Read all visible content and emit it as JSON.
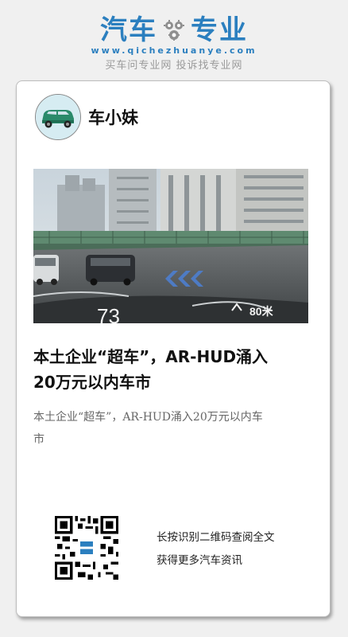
{
  "brand": {
    "name_left": "汽车",
    "name_right": "专业",
    "url": "www.qichezhuanye.com",
    "slogan": "买车问专业网 投诉找专业网",
    "color": "#2b7fbf"
  },
  "post": {
    "author": "车小妹",
    "image": {
      "speed_readout": "73",
      "distance_readout": "80米"
    },
    "title": "本土企业“超车”，AR-HUD涌入20万元以内车市",
    "summary": "本土企业“超车”，AR-HUD涌入20万元以内车市"
  },
  "share": {
    "caption_line1": "长按识别二维码查阅全文",
    "caption_line2": "获得更多汽车资讯"
  }
}
